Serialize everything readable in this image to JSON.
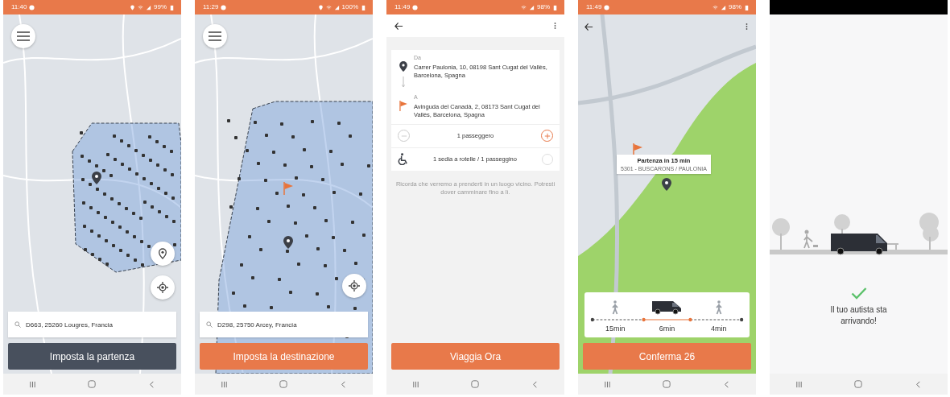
{
  "screens": [
    {
      "kind": "pickup_map",
      "status_bar": {
        "time": "11:40",
        "battery": "99%"
      },
      "search": {
        "value": "D663, 25260 Lougres, Francia"
      },
      "button": {
        "label": "Imposta la partenza"
      }
    },
    {
      "kind": "destination_map",
      "status_bar": {
        "time": "11:29",
        "battery": "100%"
      },
      "search": {
        "value": "D298, 25750 Arcey, Francia"
      },
      "button": {
        "label": "Imposta la destinazione"
      }
    },
    {
      "kind": "form",
      "status_bar": {
        "time": "11:49",
        "battery": "98%"
      },
      "stops": [
        {
          "kind": "origin",
          "label": "Da",
          "address": "Carrer Paulonia, 10, 08198 Sant Cugat del Vallès, Barcelona, Spagna"
        },
        {
          "kind": "destination",
          "label": "A",
          "address": "Avinguda del Canadà, 2, 08173 Sant Cugat del Vallès, Barcelona, Spagna"
        }
      ],
      "passengers": {
        "label": "1 passeggero",
        "can_decrease": false
      },
      "wheelchair": {
        "label": "1 sedia a rotelle / 1 passeggino",
        "checked": false
      },
      "note": "Ricorda che verremo a prenderti in un luogo vicino. Potresti dover camminare fino a lì.",
      "button": {
        "label": "Viaggia Ora"
      }
    },
    {
      "kind": "route",
      "status_bar": {
        "time": "11:49",
        "battery": "98%"
      },
      "tooltip": {
        "title": "Partenza in 15 min",
        "subtitle": "5301 - BUSCARONS / PAULONIA"
      },
      "segments": [
        {
          "kind": "walk",
          "label": "15min"
        },
        {
          "kind": "van",
          "label": "6min"
        },
        {
          "kind": "walk",
          "label": "4min"
        }
      ],
      "button": {
        "label": "Conferma 26"
      }
    },
    {
      "kind": "done",
      "message": "Il tuo autista sta arrivando!"
    }
  ]
}
